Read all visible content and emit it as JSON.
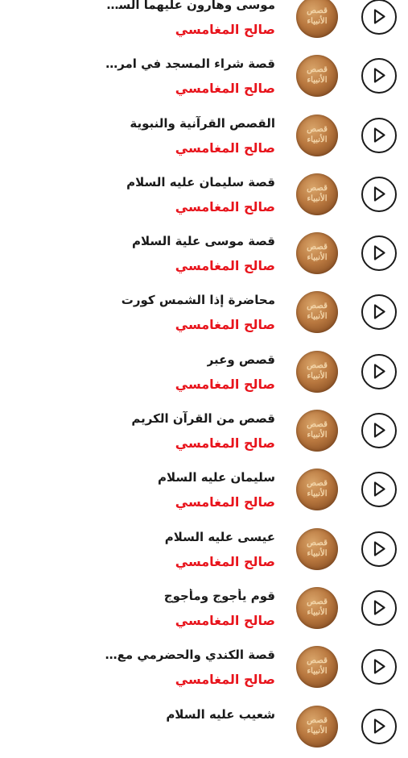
{
  "thumbnail": {
    "line1": "قصص",
    "line2": "الأنبياء"
  },
  "tracks": [
    {
      "title": "موسى وهارون عليهما السلام",
      "artist": "صالح المغامسي"
    },
    {
      "title": "قصة شراء المسجد في امريكا",
      "artist": "صالح المغامسي"
    },
    {
      "title": "القصص القرآنية والنبوية",
      "artist": "صالح المغامسي"
    },
    {
      "title": "قصة سليمان عليه السلام",
      "artist": "صالح المغامسي"
    },
    {
      "title": "قصة موسى علية السلام",
      "artist": "صالح المغامسي"
    },
    {
      "title": "محاضرة إذا الشمس كورت",
      "artist": "صالح المغامسي"
    },
    {
      "title": "قصص وعبر",
      "artist": "صالح المغامسي"
    },
    {
      "title": "قصص من القرآن الكريم",
      "artist": "صالح المغامسي"
    },
    {
      "title": "سليمان عليه السلام",
      "artist": "صالح المغامسي"
    },
    {
      "title": "عيسى عليه السلام",
      "artist": "صالح المغامسي"
    },
    {
      "title": "قوم يأجوج ومأجوج",
      "artist": "صالح المغامسي"
    },
    {
      "title": "قصة الكندي والحضرمي مع ر...",
      "artist": "صالح المغامسي"
    },
    {
      "title": "شعيب عليه السلام",
      "artist": ""
    }
  ]
}
